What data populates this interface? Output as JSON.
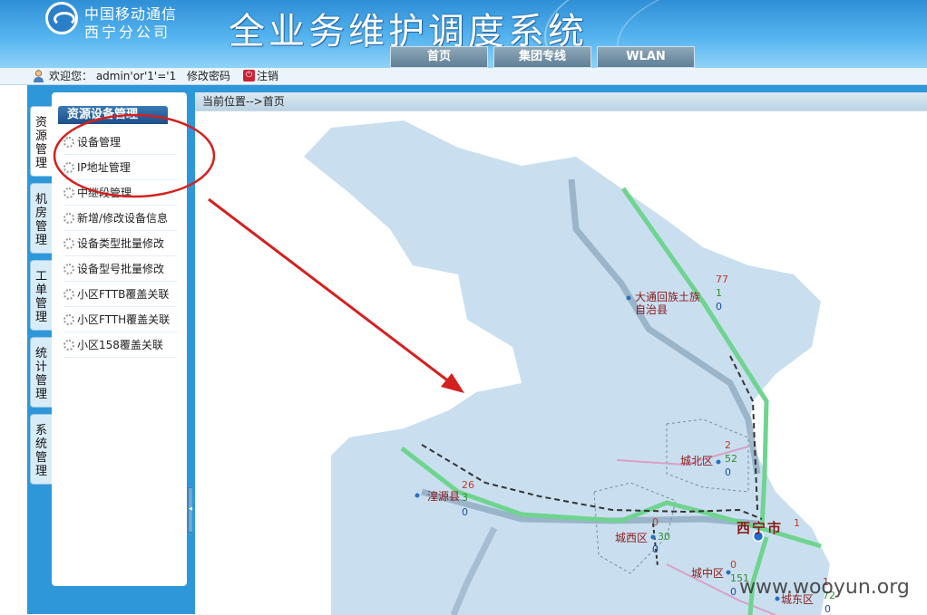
{
  "header": {
    "company_line1": "中国移动通信",
    "company_line2": "西宁分公司",
    "system_title": "全业务维护调度系统",
    "nav_tabs": [
      "首页",
      "集团专线",
      "WLAN"
    ]
  },
  "userbar": {
    "welcome": "欢迎您：  admin'or'1'='1",
    "change_password": "修改密码",
    "logout": "注销"
  },
  "side_tabs": [
    "资源管理",
    "机房管理",
    "工单管理",
    "统计管理",
    "系统管理"
  ],
  "menu": {
    "header": "资源设备管理",
    "items": [
      "设备管理",
      "IP地址管理",
      "中继段管理",
      "新增/修改设备信息",
      "设备类型批量修改",
      "设备型号批量修改",
      "小区FTTB覆盖关联",
      "小区FTTH覆盖关联",
      "小区158覆盖关联"
    ]
  },
  "breadcrumb": "当前位置-->首页",
  "map": {
    "city_label": "西宁市",
    "districts": [
      {
        "name": "大通回族土族",
        "name2": "自治县",
        "red": "77",
        "green": "1",
        "blue": "0"
      },
      {
        "name": "城北区",
        "red": "2",
        "green": "52",
        "blue": "0"
      },
      {
        "name": "湟源县",
        "red": "26",
        "green": "3",
        "blue": "0"
      },
      {
        "name": "城西区",
        "red": "0",
        "green": "30",
        "blue": "0"
      },
      {
        "name": "城中区",
        "red": "0",
        "green": "151",
        "blue": "0"
      },
      {
        "name": "城东区",
        "red": "1",
        "green": "72",
        "blue": "0"
      }
    ],
    "city_extra": "1"
  },
  "watermark": "www.wooyun.org",
  "colors": {
    "header_blue": "#2f8fd6",
    "frame_blue": "#2e97da",
    "map_land": "#c9dfef",
    "road_green": "#6fd48f",
    "road_gray": "#8fa9c0",
    "annotation_red": "#d42020"
  }
}
